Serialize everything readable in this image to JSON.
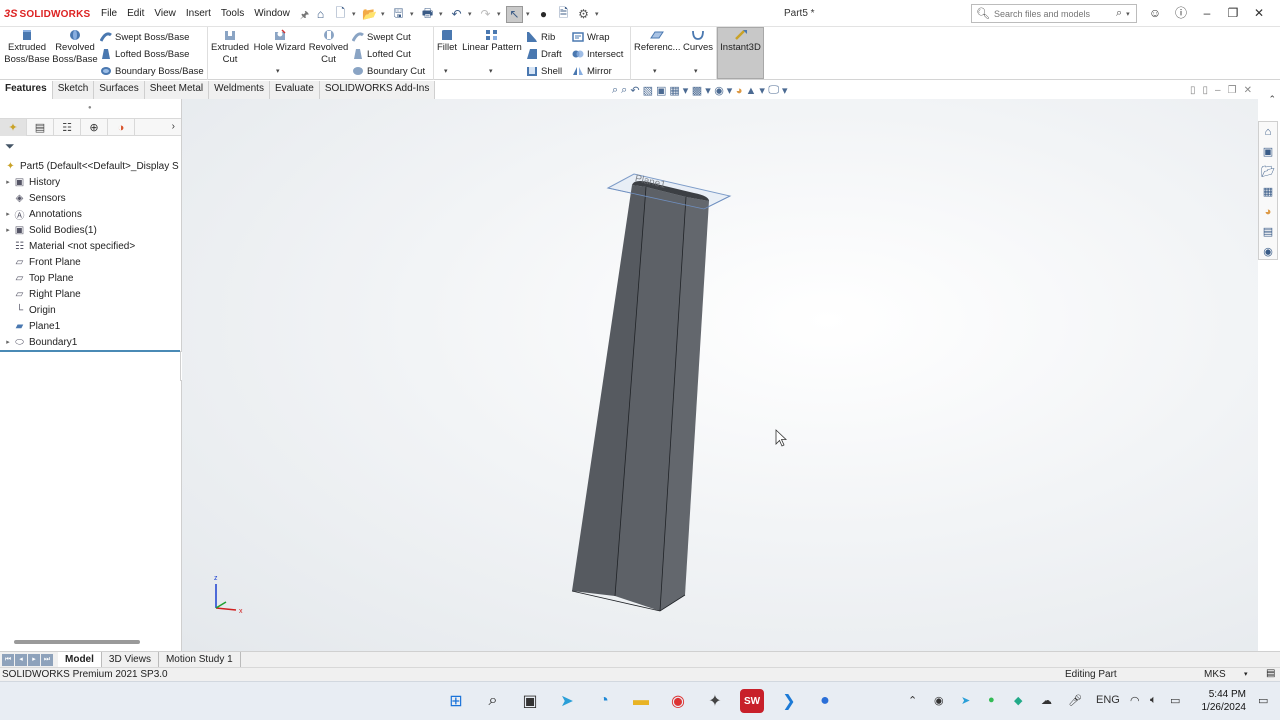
{
  "app": {
    "logo_mark": "3S",
    "logo_text": "SOLIDWORKS",
    "document_title": "Part5 *",
    "menu": [
      "File",
      "Edit",
      "View",
      "Insert",
      "Tools",
      "Window"
    ],
    "search_placeholder": "Search files and models"
  },
  "ribbon": {
    "extruded_boss": "Extruded Boss/Base",
    "revolved_boss": "Revolved Boss/Base",
    "swept_boss": "Swept Boss/Base",
    "lofted_boss": "Lofted Boss/Base",
    "boundary_boss": "Boundary Boss/Base",
    "extruded_cut": "Extruded Cut",
    "hole_wizard": "Hole Wizard",
    "revolved_cut": "Revolved Cut",
    "swept_cut": "Swept Cut",
    "lofted_cut": "Lofted Cut",
    "boundary_cut": "Boundary Cut",
    "fillet": "Fillet",
    "linear_pattern": "Linear Pattern",
    "rib": "Rib",
    "draft": "Draft",
    "shell": "Shell",
    "wrap": "Wrap",
    "intersect": "Intersect",
    "mirror": "Mirror",
    "reference": "Referenc...",
    "curves": "Curves",
    "instant3d": "Instant3D"
  },
  "command_tabs": [
    {
      "label": "Features",
      "active": true
    },
    {
      "label": "Sketch",
      "active": false
    },
    {
      "label": "Surfaces",
      "active": false
    },
    {
      "label": "Sheet Metal",
      "active": false
    },
    {
      "label": "Weldments",
      "active": false
    },
    {
      "label": "Evaluate",
      "active": false
    },
    {
      "label": "SOLIDWORKS Add-Ins",
      "active": false
    }
  ],
  "tree": {
    "root": "Part5  (Default<<Default>_Display S",
    "items": [
      {
        "label": "History",
        "expandable": true,
        "icon": "history-folder-icon"
      },
      {
        "label": "Sensors",
        "expandable": false,
        "icon": "sensors-icon"
      },
      {
        "label": "Annotations",
        "expandable": true,
        "icon": "annotations-icon"
      },
      {
        "label": "Solid Bodies(1)",
        "expandable": true,
        "icon": "solid-bodies-icon"
      },
      {
        "label": "Material <not specified>",
        "expandable": false,
        "icon": "material-icon"
      },
      {
        "label": "Front Plane",
        "expandable": false,
        "icon": "plane-icon"
      },
      {
        "label": "Top Plane",
        "expandable": false,
        "icon": "plane-icon"
      },
      {
        "label": "Right Plane",
        "expandable": false,
        "icon": "plane-icon"
      },
      {
        "label": "Origin",
        "expandable": false,
        "icon": "origin-icon"
      },
      {
        "label": "Plane1",
        "expandable": false,
        "icon": "plane-icon"
      },
      {
        "label": "Boundary1",
        "expandable": true,
        "icon": "boundary-feature-icon"
      }
    ]
  },
  "viewport": {
    "plane_label": "Plane1",
    "triad_z": "z",
    "triad_x": "x"
  },
  "bottom_tabs": [
    {
      "label": "Model",
      "active": true
    },
    {
      "label": "3D Views",
      "active": false
    },
    {
      "label": "Motion Study 1",
      "active": false
    }
  ],
  "status": {
    "product": "SOLIDWORKS Premium 2021 SP3.0",
    "mode": "Editing Part",
    "units": "MKS"
  },
  "taskbar": {
    "language": "ENG",
    "time": "5:44 PM",
    "date": "1/26/2024"
  },
  "colors": {
    "brand_red": "#d22222",
    "accent_blue": "#3b5b86",
    "model_gray": "#5b5e63",
    "rollback_bar": "#4a8ab5"
  }
}
